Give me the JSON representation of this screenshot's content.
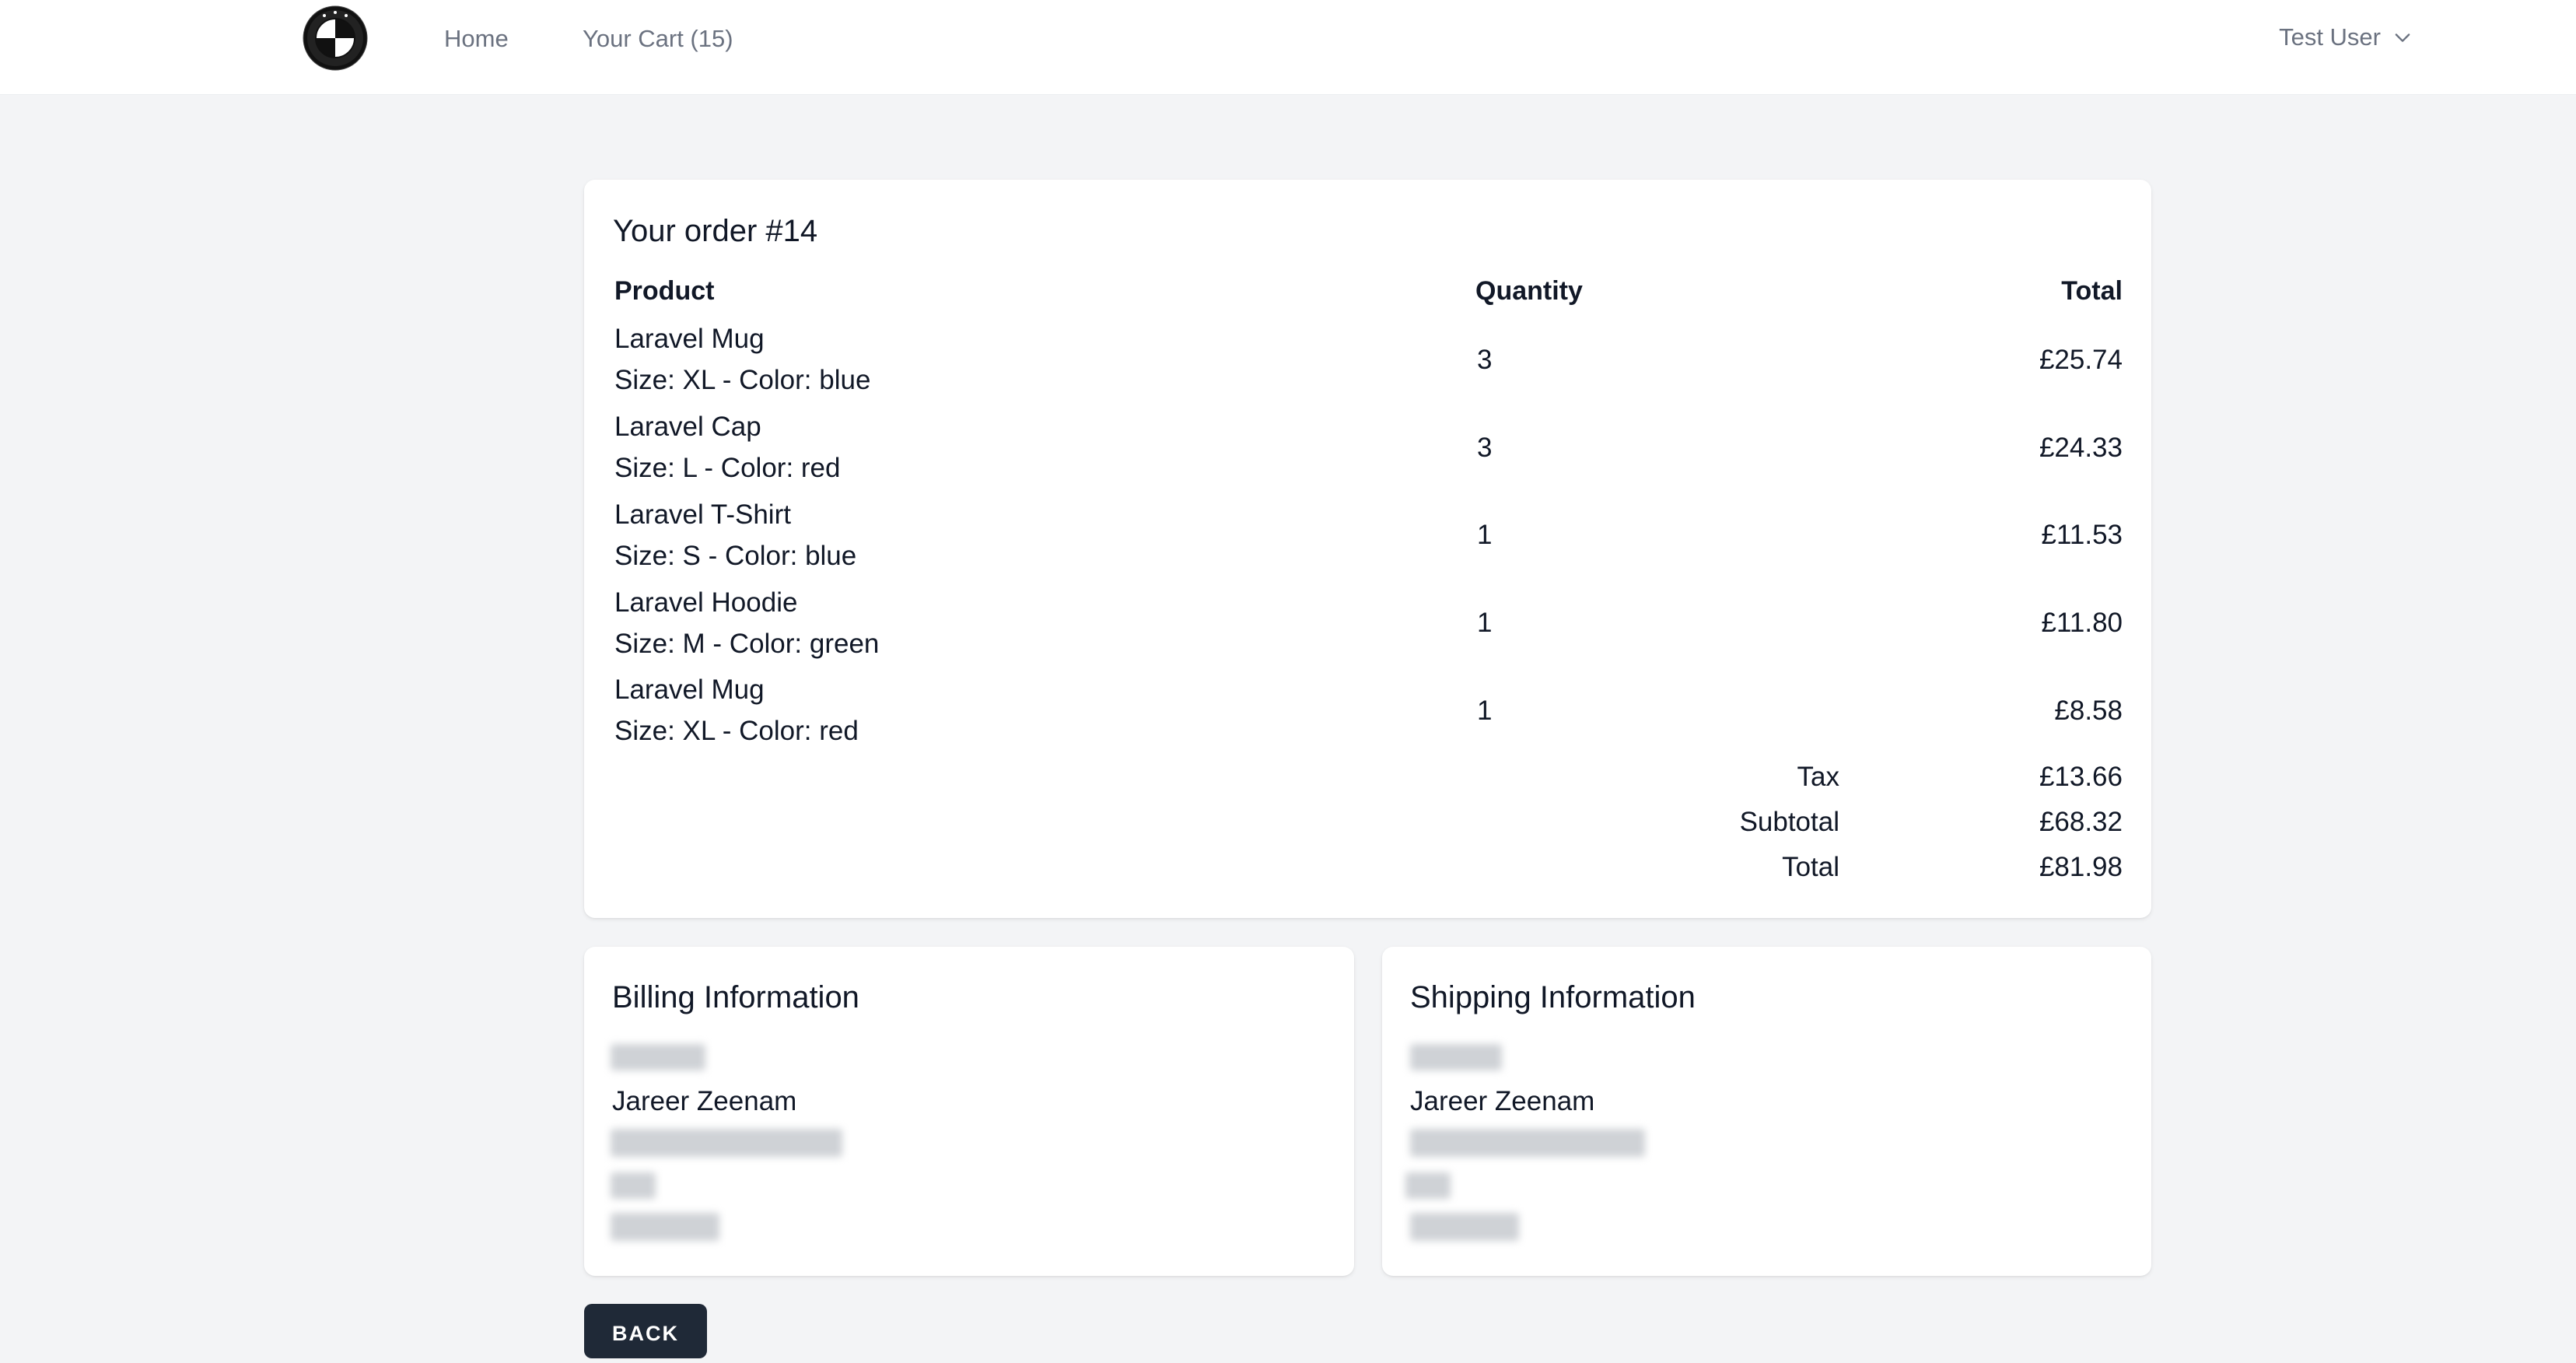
{
  "header": {
    "logo_name": "bmw-logo",
    "nav": [
      {
        "label": "Home"
      },
      {
        "label": "Your Cart (15)"
      }
    ],
    "user_name": "Test User"
  },
  "order": {
    "title": "Your order #14",
    "columns": {
      "product": "Product",
      "quantity": "Quantity",
      "total": "Total"
    },
    "items": [
      {
        "name": "Laravel Mug",
        "variant": "Size: XL - Color: blue",
        "quantity": "3",
        "total": "£25.74"
      },
      {
        "name": "Laravel Cap",
        "variant": "Size: L - Color: red",
        "quantity": "3",
        "total": "£24.33"
      },
      {
        "name": "Laravel T-Shirt",
        "variant": "Size: S - Color: blue",
        "quantity": "1",
        "total": "£11.53"
      },
      {
        "name": "Laravel Hoodie",
        "variant": "Size: M - Color: green",
        "quantity": "1",
        "total": "£11.80"
      },
      {
        "name": "Laravel Mug",
        "variant": "Size: XL - Color: red",
        "quantity": "1",
        "total": "£8.58"
      }
    ],
    "summary": {
      "tax_label": "Tax",
      "tax": "£13.66",
      "subtotal_label": "Subtotal",
      "subtotal": "£68.32",
      "total_label": "Total",
      "total": "£81.98"
    }
  },
  "billing": {
    "title": "Billing Information",
    "name": "Jareer Zeenam"
  },
  "shipping": {
    "title": "Shipping Information",
    "name": "Jareer Zeenam"
  },
  "actions": {
    "back_label": "BACK"
  },
  "colors": {
    "page_bg": "#f3f4f6",
    "card_bg": "#ffffff",
    "button_bg": "#1f2937",
    "muted_text": "#6b7280"
  }
}
